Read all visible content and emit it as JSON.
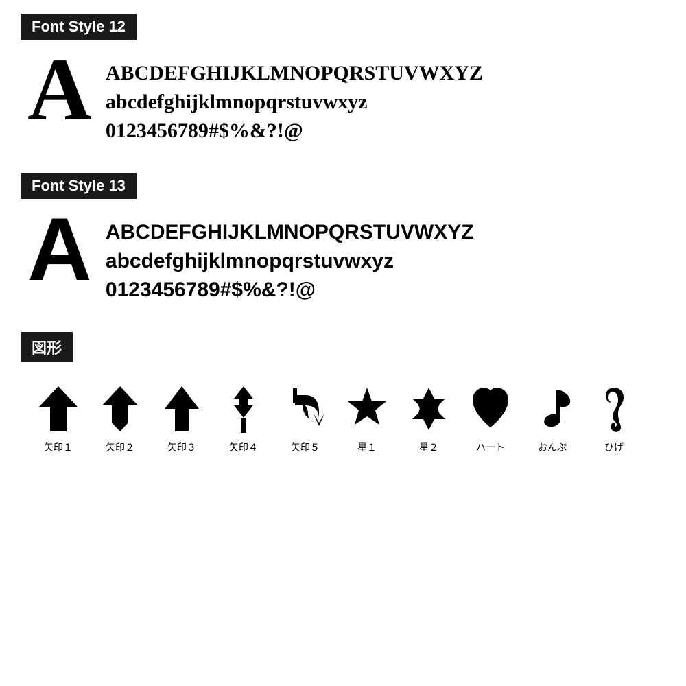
{
  "font12": {
    "label": "Font Style 12",
    "bigLetter": "A",
    "line1": "ABCDEFGHIJKLMNOPQRSTUVWXYZ",
    "line2": "abcdefghijklmnopqrstuvwxyz",
    "line3": "0123456789#$%&?!@"
  },
  "font13": {
    "label": "Font Style 13",
    "bigLetter": "A",
    "line1": "ABCDEFGHIJKLMNOPQRSTUVWXYZ",
    "line2": "abcdefghijklmnopqrstuvwxyz",
    "line3": "0123456789#$%&?!@"
  },
  "shapes": {
    "label": "図形",
    "items": [
      {
        "name": "矢印１",
        "type": "arrow1"
      },
      {
        "name": "矢印２",
        "type": "arrow2"
      },
      {
        "name": "矢印３",
        "type": "arrow3"
      },
      {
        "name": "矢印４",
        "type": "arrow4"
      },
      {
        "name": "矢印５",
        "type": "arrow5"
      },
      {
        "name": "星１",
        "type": "star1"
      },
      {
        "name": "星２",
        "type": "star2"
      },
      {
        "name": "ハート",
        "type": "heart"
      },
      {
        "name": "おんぷ",
        "type": "note"
      },
      {
        "name": "ひげ",
        "type": "mustache"
      }
    ]
  }
}
